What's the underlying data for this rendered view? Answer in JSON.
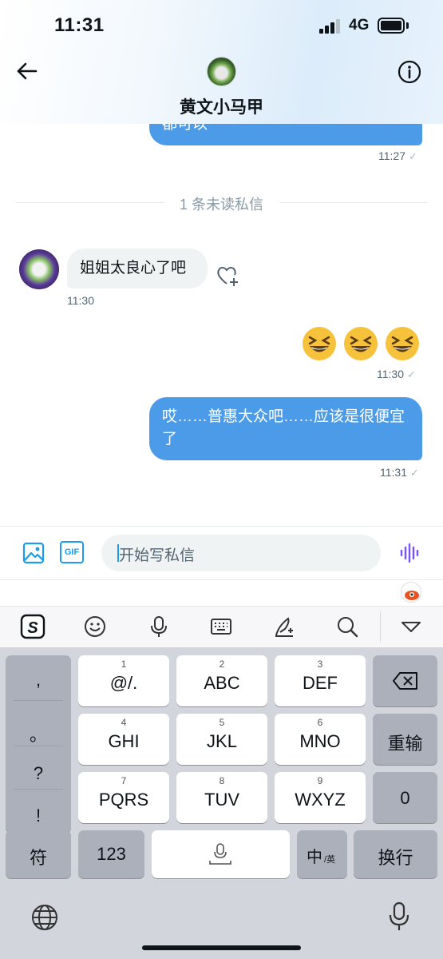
{
  "status_bar": {
    "time": "11:31",
    "network": "4G"
  },
  "header": {
    "contact_name": "黄文小马甲"
  },
  "messages": {
    "cut_off_text": "都可以",
    "cut_off_time": "11:27",
    "unread_divider": "1 条未读私信",
    "incoming_text": "姐姐太良心了吧",
    "incoming_time": "11:30",
    "emoji_time": "11:30",
    "outgoing_line1": "哎……普惠大众吧……应该是很便宜",
    "outgoing_line2": "了",
    "outgoing_time": "11:31",
    "read_check": "✓"
  },
  "composer": {
    "placeholder": "开始写私信",
    "gif_label": "GIF"
  },
  "keyboard": {
    "punct": [
      ",",
      "。",
      "?",
      "!"
    ],
    "row1": [
      {
        "num": "1",
        "label": "@/."
      },
      {
        "num": "2",
        "label": "ABC"
      },
      {
        "num": "3",
        "label": "DEF"
      }
    ],
    "row2": [
      {
        "num": "4",
        "label": "GHI"
      },
      {
        "num": "5",
        "label": "JKL"
      },
      {
        "num": "6",
        "label": "MNO"
      }
    ],
    "row3": [
      {
        "num": "7",
        "label": "PQRS"
      },
      {
        "num": "8",
        "label": "TUV"
      },
      {
        "num": "9",
        "label": "WXYZ"
      }
    ],
    "reinput": "重输",
    "zero": "0",
    "symbols": "符",
    "numbers": "123",
    "lang_main": "中",
    "lang_sub": "/英",
    "enter": "换行"
  },
  "colors": {
    "outgoing_bubble": "#4c9be8",
    "incoming_bubble": "#eff3f4",
    "accent": "#1d9bf0",
    "voice_accent": "#7856ff"
  }
}
